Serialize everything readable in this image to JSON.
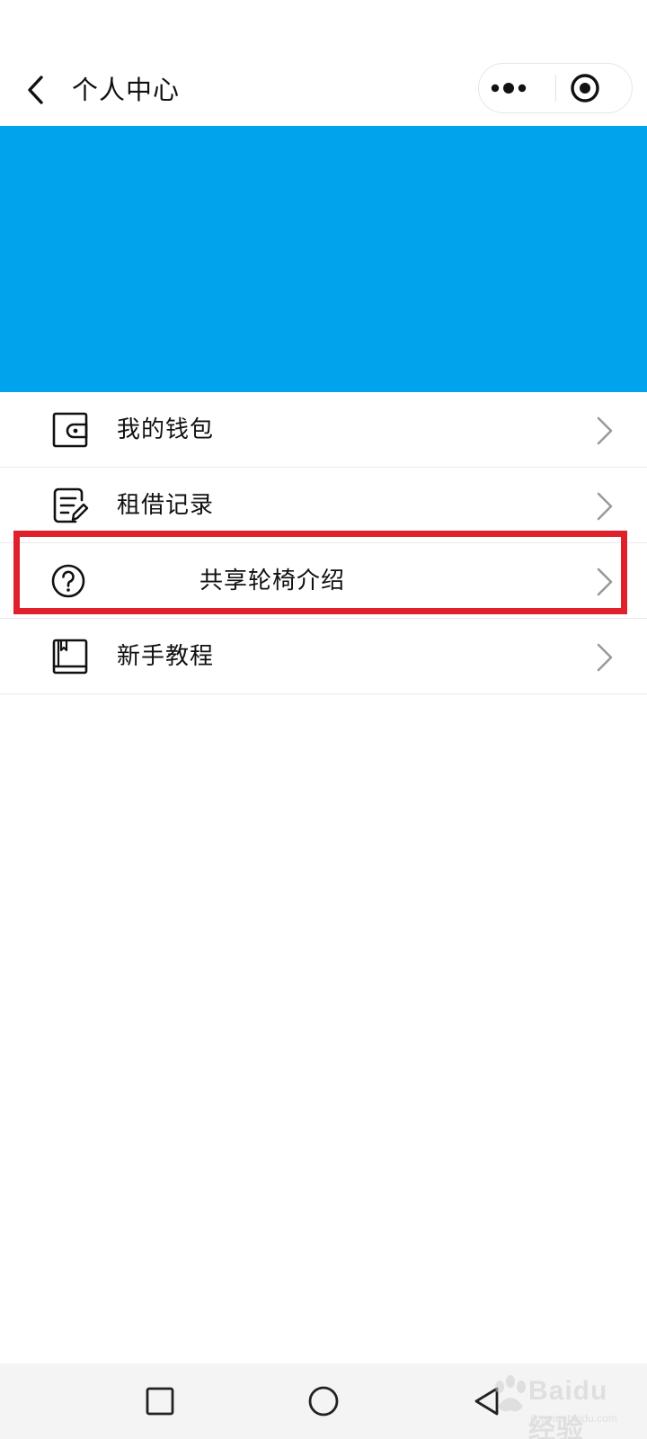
{
  "navbar": {
    "title": "个人中心",
    "back_icon": "chevron-left-icon",
    "more_icon": "more-dots-icon",
    "close_icon": "target-circle-icon"
  },
  "banner": {
    "color": "#00a3ec"
  },
  "menu": {
    "items": [
      {
        "label": "我的钱包",
        "icon": "wallet-icon"
      },
      {
        "label": "租借记录",
        "icon": "edit-note-icon"
      },
      {
        "label": "共享轮椅介绍",
        "icon": "question-circle-icon",
        "highlighted": true
      },
      {
        "label": "新手教程",
        "icon": "book-icon"
      }
    ],
    "arrow_icon": "chevron-right-icon",
    "highlight_color": "#e0202a"
  },
  "system_nav": {
    "recent_icon": "square-icon",
    "home_icon": "circle-icon",
    "back_icon": "triangle-back-icon"
  },
  "watermark": {
    "text": "Baidu经验",
    "sub": "jingyan.baidu.com"
  }
}
